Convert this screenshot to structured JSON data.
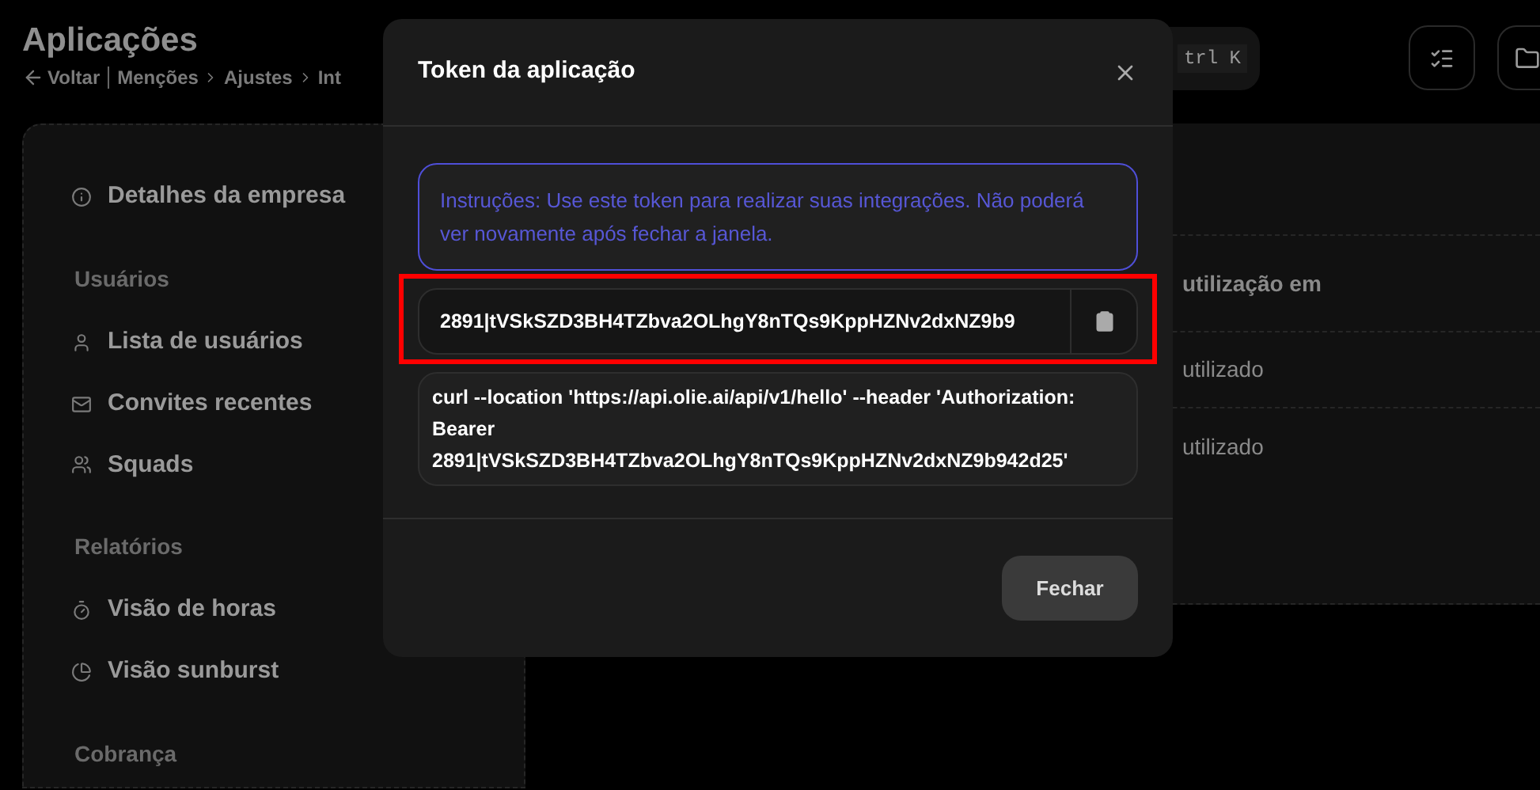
{
  "page": {
    "title": "Aplicações",
    "breadcrumb": {
      "back": "Voltar",
      "items": [
        "Menções",
        "Ajustes",
        "Int"
      ]
    },
    "shortcut": "trl K"
  },
  "sidebar": {
    "items": [
      {
        "kind": "link",
        "label": "Detalhes da empresa"
      },
      {
        "kind": "heading",
        "label": "Usuários"
      },
      {
        "kind": "link",
        "label": "Lista de usuários"
      },
      {
        "kind": "link",
        "label": "Convites recentes"
      },
      {
        "kind": "link",
        "label": "Squads"
      },
      {
        "kind": "heading",
        "label": "Relatórios"
      },
      {
        "kind": "link",
        "label": "Visão de horas"
      },
      {
        "kind": "link",
        "label": "Visão sunburst"
      },
      {
        "kind": "heading",
        "label": "Cobrança"
      }
    ]
  },
  "table": {
    "column_header": "utilização em",
    "rows": [
      {
        "cell": "utilizado"
      },
      {
        "cell": "utilizado"
      }
    ]
  },
  "dialog": {
    "title": "Token da aplicação",
    "instructions": "Instruções: Use este token para realizar suas integrações. Não poderá ver novamente após fechar a janela.",
    "token": "2891|tVSkSZD3BH4TZbva2OLhgY8nTQs9KppHZNv2dxNZ9b9",
    "curl": "curl --location 'https://api.olie.ai/api/v1/hello' --header 'Authorization: Bearer 2891|tVSkSZD3BH4TZbva2OLhgY8nTQs9KppHZNv2dxNZ9b942d25'",
    "button": "Fechar"
  }
}
